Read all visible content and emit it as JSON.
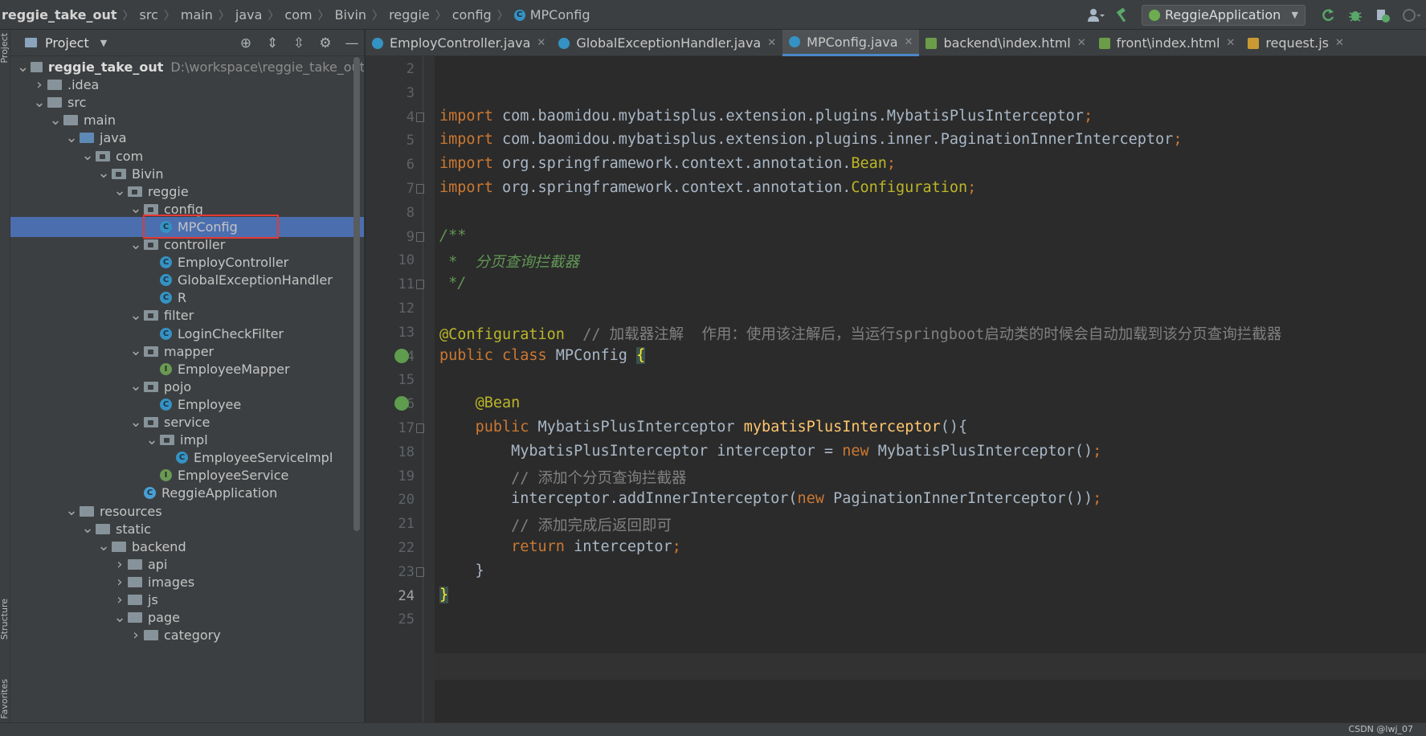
{
  "breadcrumbs": [
    "reggie_take_out",
    "src",
    "main",
    "java",
    "com",
    "Bivin",
    "reggie",
    "config",
    "MPConfig"
  ],
  "run_config": "ReggieApplication",
  "tool_windows": {
    "project": "Project",
    "structure": "Structure",
    "favorites": "Favorites"
  },
  "project_panel": {
    "title": "Project",
    "tree": [
      {
        "label": "reggie_take_out",
        "path": "D:\\workspace\\reggie_take_out",
        "depth": 0,
        "kind": "project",
        "expanded": true
      },
      {
        "label": ".idea",
        "depth": 1,
        "kind": "folder",
        "expanded": false
      },
      {
        "label": "src",
        "depth": 1,
        "kind": "folder",
        "expanded": true
      },
      {
        "label": "main",
        "depth": 2,
        "kind": "folder",
        "expanded": true
      },
      {
        "label": "java",
        "depth": 3,
        "kind": "source",
        "expanded": true
      },
      {
        "label": "com",
        "depth": 4,
        "kind": "package",
        "expanded": true
      },
      {
        "label": "Bivin",
        "depth": 5,
        "kind": "package",
        "expanded": true
      },
      {
        "label": "reggie",
        "depth": 6,
        "kind": "package",
        "expanded": true
      },
      {
        "label": "config",
        "depth": 7,
        "kind": "package",
        "expanded": true
      },
      {
        "label": "MPConfig",
        "depth": 8,
        "kind": "class",
        "selected": true
      },
      {
        "label": "controller",
        "depth": 7,
        "kind": "package",
        "expanded": true
      },
      {
        "label": "EmployController",
        "depth": 8,
        "kind": "class"
      },
      {
        "label": "GlobalExceptionHandler",
        "depth": 8,
        "kind": "class"
      },
      {
        "label": "R",
        "depth": 8,
        "kind": "class"
      },
      {
        "label": "filter",
        "depth": 7,
        "kind": "package",
        "expanded": true
      },
      {
        "label": "LoginCheckFilter",
        "depth": 8,
        "kind": "class"
      },
      {
        "label": "mapper",
        "depth": 7,
        "kind": "package",
        "expanded": true
      },
      {
        "label": "EmployeeMapper",
        "depth": 8,
        "kind": "interface"
      },
      {
        "label": "pojo",
        "depth": 7,
        "kind": "package",
        "expanded": true
      },
      {
        "label": "Employee",
        "depth": 8,
        "kind": "class"
      },
      {
        "label": "service",
        "depth": 7,
        "kind": "package",
        "expanded": true
      },
      {
        "label": "impl",
        "depth": 8,
        "kind": "package",
        "expanded": true
      },
      {
        "label": "EmployeeServiceImpl",
        "depth": 9,
        "kind": "class"
      },
      {
        "label": "EmployeeService",
        "depth": 8,
        "kind": "interface"
      },
      {
        "label": "ReggieApplication",
        "depth": 7,
        "kind": "app"
      },
      {
        "label": "resources",
        "depth": 3,
        "kind": "folder",
        "expanded": true
      },
      {
        "label": "static",
        "depth": 4,
        "kind": "folder",
        "expanded": true
      },
      {
        "label": "backend",
        "depth": 5,
        "kind": "folder",
        "expanded": true
      },
      {
        "label": "api",
        "depth": 6,
        "kind": "folder",
        "expanded": false
      },
      {
        "label": "images",
        "depth": 6,
        "kind": "folder",
        "expanded": false
      },
      {
        "label": "js",
        "depth": 6,
        "kind": "folder",
        "expanded": false
      },
      {
        "label": "page",
        "depth": 6,
        "kind": "folder",
        "expanded": true
      },
      {
        "label": "category",
        "depth": 7,
        "kind": "folder",
        "expanded": false
      }
    ]
  },
  "editor_tabs": [
    {
      "label": "EmployController.java",
      "type": "java",
      "active": false
    },
    {
      "label": "GlobalExceptionHandler.java",
      "type": "java",
      "active": false
    },
    {
      "label": "MPConfig.java",
      "type": "java",
      "active": true
    },
    {
      "label": "backend\\index.html",
      "type": "html",
      "active": false
    },
    {
      "label": "front\\index.html",
      "type": "html",
      "active": false
    },
    {
      "label": "request.js",
      "type": "js",
      "active": false
    }
  ],
  "editor": {
    "current_line": 24,
    "lines": [
      {
        "n": 2,
        "tokens": []
      },
      {
        "n": 3,
        "tokens": []
      },
      {
        "n": 4,
        "tokens": [
          [
            "kw",
            "import "
          ],
          [
            "",
            "com.baomidou.mybatisplus.extension.plugins.MybatisPlusInterceptor"
          ],
          [
            "kw",
            ";"
          ]
        ]
      },
      {
        "n": 5,
        "tokens": [
          [
            "kw",
            "import "
          ],
          [
            "",
            "com.baomidou.mybatisplus.extension.plugins.inner.PaginationInnerInterceptor"
          ],
          [
            "kw",
            ";"
          ]
        ]
      },
      {
        "n": 6,
        "tokens": [
          [
            "kw",
            "import "
          ],
          [
            "",
            "org.springframework.context.annotation."
          ],
          [
            "ann",
            "Bean"
          ],
          [
            "kw",
            ";"
          ]
        ]
      },
      {
        "n": 7,
        "tokens": [
          [
            "kw",
            "import "
          ],
          [
            "",
            "org.springframework.context.annotation."
          ],
          [
            "ann",
            "Configuration"
          ],
          [
            "kw",
            ";"
          ]
        ]
      },
      {
        "n": 8,
        "tokens": []
      },
      {
        "n": 9,
        "tokens": [
          [
            "doc",
            "/**"
          ]
        ]
      },
      {
        "n": 10,
        "tokens": [
          [
            "doc",
            " *  分页查询拦截器"
          ]
        ]
      },
      {
        "n": 11,
        "tokens": [
          [
            "doc",
            " */"
          ]
        ]
      },
      {
        "n": 12,
        "tokens": []
      },
      {
        "n": 13,
        "tokens": [
          [
            "ann",
            "@Configuration"
          ],
          [
            "cmt",
            "  // 加载器注解  作用：使用该注解后，当运行springboot启动类的时候会自动加载到该分页查询拦截器"
          ]
        ]
      },
      {
        "n": 14,
        "tokens": [
          [
            "kw",
            "public class "
          ],
          [
            "",
            "MPConfig "
          ],
          [
            "brace",
            "{"
          ]
        ]
      },
      {
        "n": 15,
        "tokens": []
      },
      {
        "n": 16,
        "tokens": [
          [
            "",
            "    "
          ],
          [
            "ann",
            "@Bean"
          ]
        ]
      },
      {
        "n": 17,
        "tokens": [
          [
            "",
            "    "
          ],
          [
            "kw",
            "public "
          ],
          [
            "",
            "MybatisPlusInterceptor "
          ],
          [
            "fn",
            "mybatisPlusInterceptor"
          ],
          [
            "",
            "(){"
          ]
        ]
      },
      {
        "n": 18,
        "tokens": [
          [
            "",
            "        MybatisPlusInterceptor interceptor = "
          ],
          [
            "kw",
            "new "
          ],
          [
            "",
            "MybatisPlusInterceptor()"
          ],
          [
            "kw",
            ";"
          ]
        ]
      },
      {
        "n": 19,
        "tokens": [
          [
            "cmt",
            "        // 添加个分页查询拦截器"
          ]
        ]
      },
      {
        "n": 20,
        "tokens": [
          [
            "",
            "        interceptor.addInnerInterceptor("
          ],
          [
            "kw",
            "new "
          ],
          [
            "",
            "PaginationInnerInterceptor())"
          ],
          [
            "kw",
            ";"
          ]
        ]
      },
      {
        "n": 21,
        "tokens": [
          [
            "cmt",
            "        // 添加完成后返回即可"
          ]
        ]
      },
      {
        "n": 22,
        "tokens": [
          [
            "",
            "        "
          ],
          [
            "kw",
            "return "
          ],
          [
            "",
            "interceptor"
          ],
          [
            "kw",
            ";"
          ]
        ]
      },
      {
        "n": 23,
        "tokens": [
          [
            "",
            "    }"
          ]
        ]
      },
      {
        "n": 24,
        "tokens": [
          [
            "brace",
            "}"
          ]
        ]
      },
      {
        "n": 25,
        "tokens": []
      }
    ]
  },
  "watermark": "CSDN @lwj_07"
}
